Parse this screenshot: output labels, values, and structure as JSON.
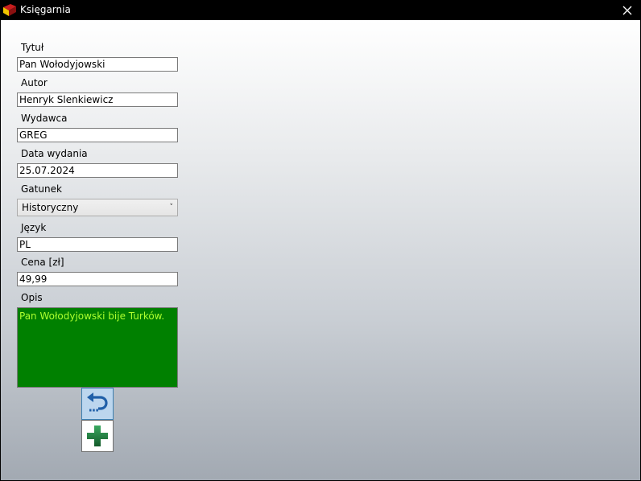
{
  "window": {
    "title": "Księgarnia",
    "icon": "app-book-icon"
  },
  "form": {
    "title_label": "Tytuł",
    "title_value": "Pan Wołodyjowski",
    "author_label": "Autor",
    "author_value": "Henryk Slenkiewicz",
    "publisher_label": "Wydawca",
    "publisher_value": "GREG",
    "date_label": "Data wydania",
    "date_value": "25.07.2024",
    "genre_label": "Gatunek",
    "genre_value": "Historyczny",
    "language_label": "Język",
    "language_value": "PL",
    "price_label": "Cena [zł]",
    "price_value": "49,99",
    "description_label": "Opis",
    "description_value": "Pan Wołodyjowski bije Turków."
  },
  "buttons": {
    "undo_icon": "undo-icon",
    "add_icon": "plus-icon"
  },
  "colors": {
    "description_bg": "#008000",
    "description_text": "#adff2f",
    "plus_green": "#1e7a3a"
  }
}
